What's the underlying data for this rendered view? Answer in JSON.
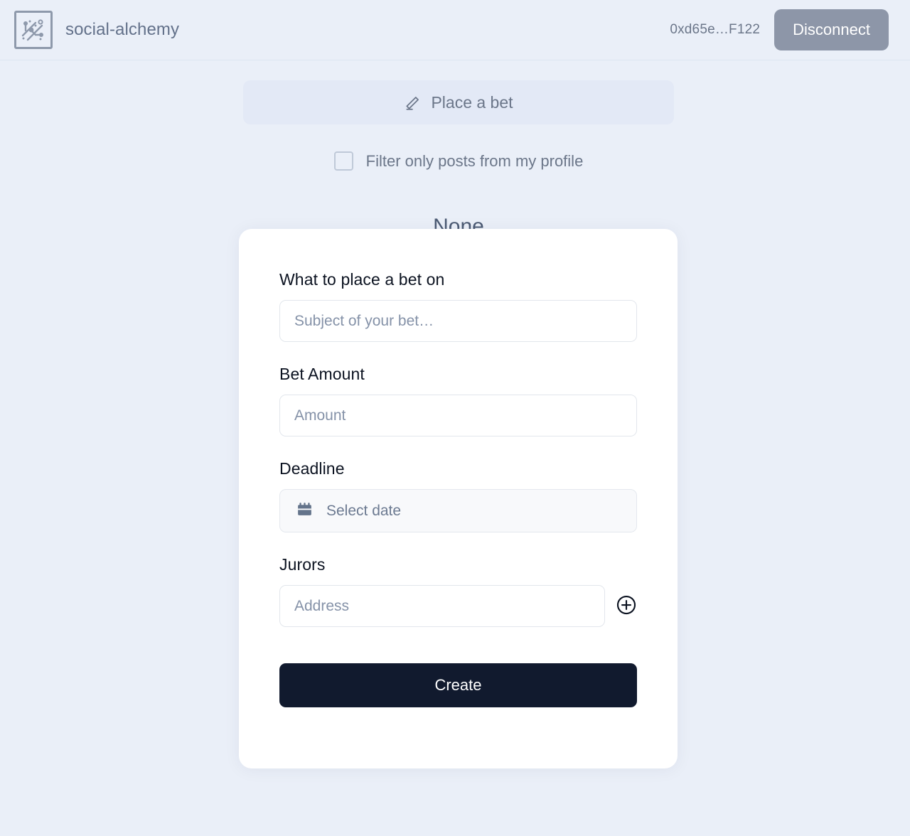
{
  "header": {
    "logo_icon": "circuit-board-logo-icon",
    "brand_name": "social-alchemy",
    "wallet_address": "0xd65e…F122",
    "disconnect_label": "Disconnect"
  },
  "main": {
    "place_bet_label": "Place a bet",
    "place_bet_icon": "pencil-icon",
    "filter_checkbox_label": "Filter only posts from my profile",
    "filter_checkbox_checked": false,
    "empty_state_text": "None"
  },
  "modal": {
    "subject": {
      "label": "What to place a bet on",
      "placeholder": "Subject of your bet…",
      "value": ""
    },
    "amount": {
      "label": "Bet Amount",
      "placeholder": "Amount",
      "value": ""
    },
    "deadline": {
      "label": "Deadline",
      "placeholder": "Select date",
      "icon": "calendar-icon",
      "value": ""
    },
    "jurors": {
      "label": "Jurors",
      "placeholder": "Address",
      "value": "",
      "add_icon": "plus-circle-icon"
    },
    "submit_label": "Create"
  },
  "colors": {
    "page_background": "#eaeff8",
    "accent_dark": "#111a2e",
    "muted_text": "#6b7689",
    "disconnect_button": "#8d96a8"
  }
}
